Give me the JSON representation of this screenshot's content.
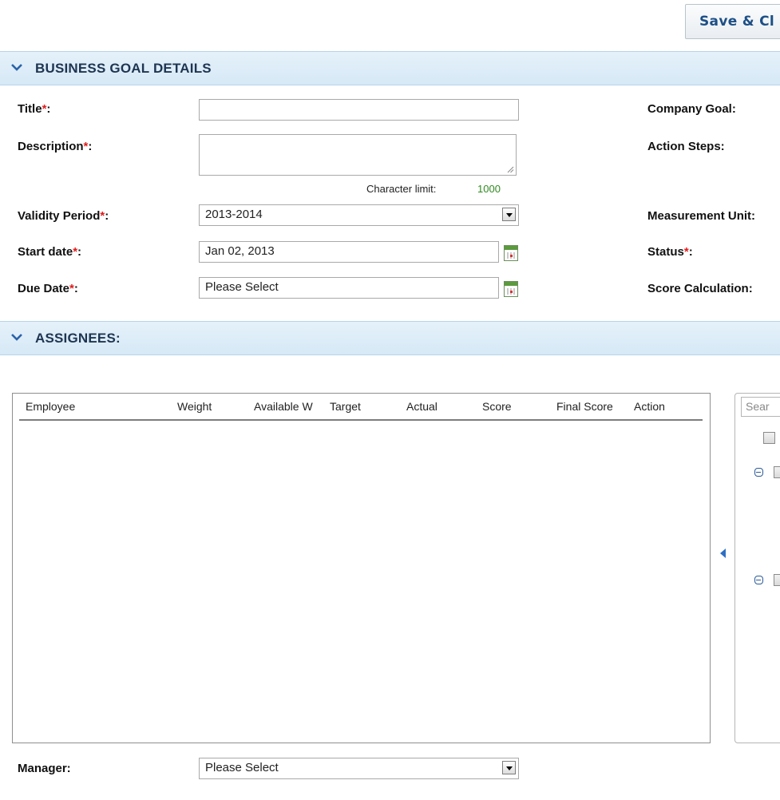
{
  "toolbar": {
    "save_close_label": "Save & Cl"
  },
  "sections": {
    "details_title": "BUSINESS GOAL DETAILS",
    "assignees_title": "ASSIGNEES:"
  },
  "form": {
    "title_label": "Title",
    "description_label": "Description",
    "char_limit_label": "Character limit:",
    "char_limit_value": "1000",
    "validity_label": "Validity Period",
    "validity_value": "2013-2014",
    "start_label": "Start date",
    "start_value": "Jan 02, 2013",
    "due_label": "Due Date",
    "due_value": "Please Select",
    "required_mark": "*",
    "colon": ":",
    "company_goal_label": "Company Goal:",
    "action_steps_label": "Action Steps:",
    "measurement_label": "Measurement Unit:",
    "status_label": "Status",
    "score_calc_label": "Score Calculation:"
  },
  "grid": {
    "columns": [
      "Employee",
      "Weight",
      "Available W",
      "Target",
      "Actual",
      "Score",
      "Final Score",
      "Action"
    ]
  },
  "tree": {
    "search_placeholder": "Sear"
  },
  "manager": {
    "label": "Manager:",
    "value": "Please Select"
  }
}
